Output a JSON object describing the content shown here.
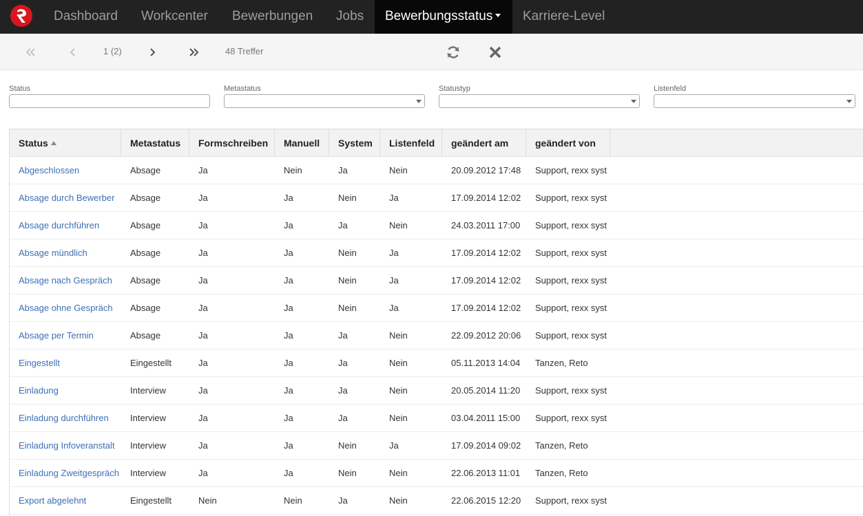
{
  "nav": {
    "items": [
      {
        "label": "Dashboard"
      },
      {
        "label": "Workcenter"
      },
      {
        "label": "Bewerbungen"
      },
      {
        "label": "Jobs"
      },
      {
        "label": "Bewerbungsstatus"
      },
      {
        "label": "Karriere-Level"
      }
    ],
    "active": "Bewerbungsstatus"
  },
  "pager": {
    "page_text": "1 (2)",
    "hits_text": "48 Treffer"
  },
  "filters": {
    "status_label": "Status",
    "metastatus_label": "Metastatus",
    "statustyp_label": "Statustyp",
    "listenfeld_label": "Listenfeld"
  },
  "table": {
    "columns": [
      "Status",
      "Metastatus",
      "Formschreiben",
      "Manuell",
      "System",
      "Listenfeld",
      "geändert am",
      "geändert von"
    ],
    "rows": [
      [
        "Abgeschlossen",
        "Absage",
        "Ja",
        "Nein",
        "Ja",
        "Nein",
        "20.09.2012 17:48",
        "Support, rexx syst"
      ],
      [
        "Absage durch Bewerber",
        "Absage",
        "Ja",
        "Ja",
        "Nein",
        "Ja",
        "17.09.2014 12:02",
        "Support, rexx syst"
      ],
      [
        "Absage durchführen",
        "Absage",
        "Ja",
        "Ja",
        "Ja",
        "Nein",
        "24.03.2011 17:00",
        "Support, rexx syst"
      ],
      [
        "Absage mündlich",
        "Absage",
        "Ja",
        "Ja",
        "Nein",
        "Ja",
        "17.09.2014 12:02",
        "Support, rexx syst"
      ],
      [
        "Absage nach Gespräch",
        "Absage",
        "Ja",
        "Ja",
        "Nein",
        "Ja",
        "17.09.2014 12:02",
        "Support, rexx syst"
      ],
      [
        "Absage ohne Gespräch",
        "Absage",
        "Ja",
        "Ja",
        "Nein",
        "Ja",
        "17.09.2014 12:02",
        "Support, rexx syst"
      ],
      [
        "Absage per Termin",
        "Absage",
        "Ja",
        "Ja",
        "Ja",
        "Nein",
        "22.09.2012 20:06",
        "Support, rexx syst"
      ],
      [
        "Eingestellt",
        "Eingestellt",
        "Ja",
        "Ja",
        "Ja",
        "Nein",
        "05.11.2013 14:04",
        "Tanzen, Reto"
      ],
      [
        "Einladung",
        "Interview",
        "Ja",
        "Ja",
        "Ja",
        "Nein",
        "20.05.2014 11:20",
        "Support, rexx syst"
      ],
      [
        "Einladung durchführen",
        "Interview",
        "Ja",
        "Ja",
        "Ja",
        "Nein",
        "03.04.2011 15:00",
        "Support, rexx syst"
      ],
      [
        "Einladung Infoveranstalt",
        "Interview",
        "Ja",
        "Ja",
        "Nein",
        "Ja",
        "17.09.2014 09:02",
        "Tanzen, Reto"
      ],
      [
        "Einladung Zweitgespräch",
        "Interview",
        "Ja",
        "Ja",
        "Nein",
        "Nein",
        "22.06.2013 11:01",
        "Tanzen, Reto"
      ],
      [
        "Export abgelehnt",
        "Eingestellt",
        "Nein",
        "Nein",
        "Ja",
        "Nein",
        "22.06.2015 12:20",
        "Support, rexx syst"
      ]
    ]
  },
  "colors": {
    "nav_bg": "#222222",
    "nav_active_bg": "#080808",
    "link": "#3d6fb6",
    "brand_red": "#d9161e"
  },
  "icons": [
    "logo-icon",
    "first-page-icon",
    "prev-page-icon",
    "next-page-icon",
    "last-page-icon",
    "refresh-icon",
    "close-icon",
    "sort-asc-icon",
    "dropdown-arrow-icon"
  ]
}
